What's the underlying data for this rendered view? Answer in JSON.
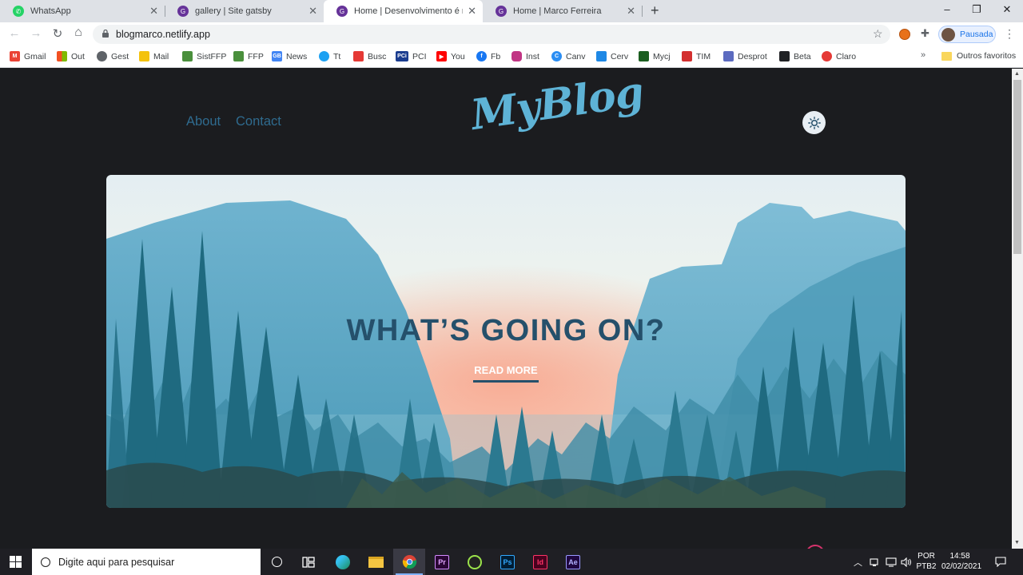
{
  "browser": {
    "tabs": [
      {
        "title": "WhatsApp",
        "icon": "whatsapp-icon",
        "active": false
      },
      {
        "title": "gallery | Site gatsby",
        "icon": "gatsby-icon",
        "active": false
      },
      {
        "title": "Home | Desenvolvimento é minh",
        "icon": "gatsby-icon",
        "active": true
      },
      {
        "title": "Home | Marco Ferreira",
        "icon": "gatsby-icon",
        "active": false
      }
    ],
    "new_tab": "+",
    "window_controls": {
      "minimize": "–",
      "restore": "❐",
      "close": "✕"
    },
    "nav": {
      "back": "←",
      "forward": "→",
      "reload": "↻",
      "home": "⌂"
    },
    "url": "blogmarco.netlify.app",
    "bookmark_star": "☆",
    "extensions_icon": "✚",
    "profile_label": "Pausada",
    "menu_icon": "⋮",
    "bookmarks": [
      {
        "label": "Gmail",
        "icon": "gmail-icon",
        "color": "#ea4335"
      },
      {
        "label": "Out",
        "icon": "office-icon",
        "color": "#f25022"
      },
      {
        "label": "Gest",
        "icon": "globe-icon",
        "color": "#5f6368"
      },
      {
        "label": "Mail",
        "icon": "crown-icon",
        "color": "#f4c20d"
      },
      {
        "label": "SistFFP",
        "icon": "badge-icon",
        "color": "#4a8f3c"
      },
      {
        "label": "FFP",
        "icon": "badge-icon",
        "color": "#4a8f3c"
      },
      {
        "label": "News",
        "icon": "news-icon",
        "color": "#4285f4"
      },
      {
        "label": "Tt",
        "icon": "twitter-icon",
        "color": "#1da1f2"
      },
      {
        "label": "Busc",
        "icon": "busc-icon",
        "color": "#e53935"
      },
      {
        "label": "PCI",
        "icon": "pci-icon",
        "color": "#1a3c8f"
      },
      {
        "label": "You",
        "icon": "youtube-icon",
        "color": "#ff0000"
      },
      {
        "label": "Fb",
        "icon": "facebook-icon",
        "color": "#1877f2"
      },
      {
        "label": "Inst",
        "icon": "instagram-icon",
        "color": "#c13584"
      },
      {
        "label": "Canv",
        "icon": "canva-icon",
        "color": "#2b8ef3"
      },
      {
        "label": "Cerv",
        "icon": "cerv-icon",
        "color": "#1e88e5"
      },
      {
        "label": "Mycj",
        "icon": "mycj-icon",
        "color": "#1b5e20"
      },
      {
        "label": "TIM",
        "icon": "tim-icon",
        "color": "#d32f2f"
      },
      {
        "label": "Desprot",
        "icon": "desprot-icon",
        "color": "#5c6bc0"
      },
      {
        "label": "Beta",
        "icon": "beta-icon",
        "color": "#202124"
      },
      {
        "label": "Claro",
        "icon": "claro-icon",
        "color": "#e53935"
      }
    ],
    "bookmarks_more": "»",
    "other_bookmarks": "Outros favoritos"
  },
  "site": {
    "nav": [
      {
        "label": "About"
      },
      {
        "label": "Contact"
      }
    ],
    "logo": "MyBlog",
    "theme_toggle_icon": "sun-icon",
    "hero": {
      "title": "WHAT’S GOING ON?",
      "button": "READ MORE"
    },
    "colors": {
      "background": "#1b1c1f",
      "accent": "#5eb3d6",
      "nav": "#2f6b8f",
      "hero_text": "#25506b"
    }
  },
  "taskbar": {
    "search_placeholder": "Digite aqui para pesquisar",
    "apps": [
      {
        "name": "cortana",
        "label": "O"
      },
      {
        "name": "task-view",
        "label": ""
      },
      {
        "name": "edge",
        "label": ""
      },
      {
        "name": "file-explorer",
        "label": ""
      },
      {
        "name": "chrome",
        "label": ""
      },
      {
        "name": "premiere",
        "label": "Pr"
      },
      {
        "name": "inkscape",
        "label": ""
      },
      {
        "name": "photoshop",
        "label": "Ps"
      },
      {
        "name": "indesign",
        "label": "Id"
      },
      {
        "name": "after-effects",
        "label": "Ae"
      }
    ],
    "language": "POR",
    "layout": "PTB2",
    "time": "14:58",
    "date": "02/02/2021"
  }
}
